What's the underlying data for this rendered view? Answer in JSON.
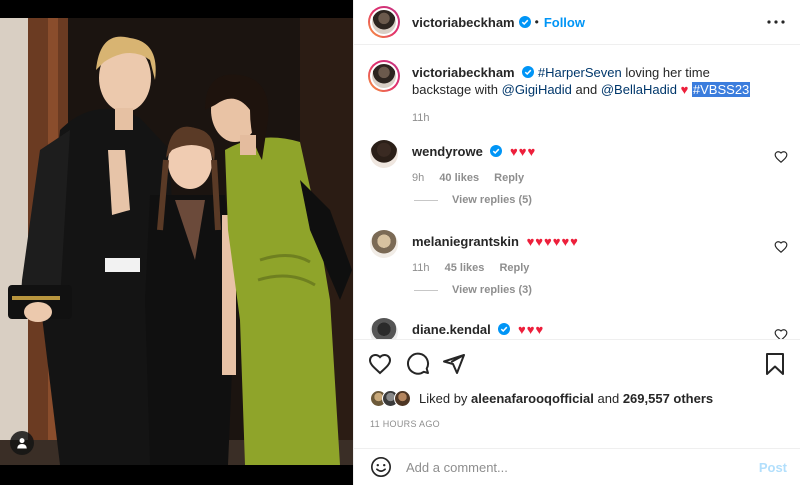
{
  "post": {
    "author": "victoriabeckham",
    "follow_label": "Follow",
    "dot": "•",
    "caption": {
      "tag1": "#HarperSeven",
      "text1": "loving her time backstage with",
      "mention1": "@GigiHadid",
      "and": "and",
      "mention2": "@BellaHadid",
      "heart": "♥",
      "tag2": "#VBSS23",
      "time": "11h"
    },
    "comments": [
      {
        "user": "wendyrowe",
        "hearts": "♥♥♥",
        "time": "9h",
        "likes": "40 likes",
        "reply_label": "Reply",
        "replies": "View replies (5)"
      },
      {
        "user": "melaniegrantskin",
        "hearts": "♥♥♥♥♥♥",
        "time": "11h",
        "likes": "45 likes",
        "reply_label": "Reply",
        "replies": "View replies (3)"
      },
      {
        "user": "diane.kendal",
        "hearts": "♥♥♥"
      }
    ],
    "liked_by_prefix": "Liked by",
    "liked_by_user": "aleenafarooqofficial",
    "liked_by_and": "and",
    "liked_by_count": "269,557 others",
    "posted_ago": "11 HOURS AGO",
    "comment_placeholder": "Add a comment...",
    "post_label": "Post"
  },
  "colors": {
    "accent": "#0095f6",
    "heart": "#ed1f3b",
    "muted": "#8e8e8e",
    "post_disabled": "#b2dffc",
    "dress_green": "#8fa42a"
  },
  "icons": {
    "header": [
      "verified-badge-icon",
      "more-options-icon"
    ],
    "actions": [
      "like-heart-icon",
      "comment-bubble-icon",
      "share-plane-icon",
      "bookmark-icon"
    ],
    "other": [
      "user-tag-icon",
      "emoji-smile-icon"
    ]
  }
}
